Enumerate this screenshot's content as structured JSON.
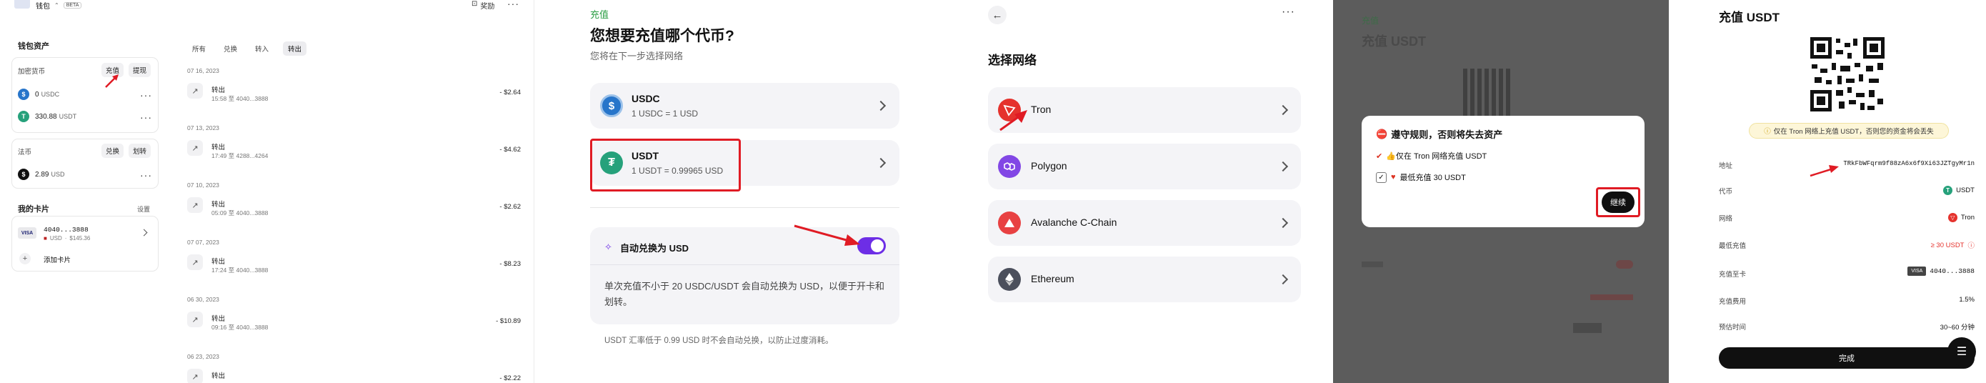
{
  "panel1": {
    "wallet_title": "钱包",
    "beta_badge": "BETA",
    "rewards_label": "奖励",
    "assets_title": "钱包资产",
    "crypto_title": "加密货币",
    "deposit_label": "充值",
    "withdraw_label": "提现",
    "crypto_rows": [
      {
        "amount": "0",
        "symbol": "USDC"
      },
      {
        "amount": "330.88",
        "symbol": "USDT"
      }
    ],
    "fiat_title": "法币",
    "exchange_label": "兑换",
    "transfer_label": "划转",
    "fiat_rows": [
      {
        "amount": "2.89",
        "symbol": "USD"
      }
    ],
    "cards_title": "我的卡片",
    "settings_label": "设置",
    "card": {
      "brand": "VISA",
      "number": "4040...3888",
      "currency": "USD",
      "balance": "$145.36"
    },
    "add_card_label": "添加卡片",
    "tabs": [
      "所有",
      "兑换",
      "转入",
      "转出"
    ],
    "transactions": [
      {
        "date": "07 16, 2023",
        "title": "转出",
        "detail": "15:58 至 4040...3888",
        "amount": "- $2.64"
      },
      {
        "date": "07 13, 2023",
        "title": "转出",
        "detail": "17:49 至 4288...4264",
        "amount": "- $4.62"
      },
      {
        "date": "07 10, 2023",
        "title": "转出",
        "detail": "05:09 至 4040...3888",
        "amount": "- $2.62"
      },
      {
        "date": "07 07, 2023",
        "title": "转出",
        "detail": "17:24 至 4040...3888",
        "amount": "- $8.23"
      },
      {
        "date": "06 30, 2023",
        "title": "转出",
        "detail": "09:16 至 4040...3888",
        "amount": "- $10.89"
      },
      {
        "date": "06 23, 2023",
        "title": "转出",
        "detail": "",
        "amount": "- $2.22"
      }
    ]
  },
  "panel2": {
    "step_label": "充值",
    "heading": "您想要充值哪个代币?",
    "subheading": "您将在下一步选择网络",
    "options": [
      {
        "name": "USDC",
        "rate": "1 USDC = 1 USD"
      },
      {
        "name": "USDT",
        "rate": "1 USDT = 0.99965 USD"
      }
    ],
    "auto_convert_label": "自动兑换为 USD",
    "auto_convert_on": true,
    "auto_convert_desc": "单次充值不小于 20 USDC/USDT 会自动兑换为 USD，以便于开卡和划转。",
    "footnote": "USDT 汇率低于 0.99 USD 时不会自动兑换，以防止过度消耗。"
  },
  "panel3": {
    "heading": "选择网络",
    "networks": [
      "Tron",
      "Polygon",
      "Avalanche C-Chain",
      "Ethereum"
    ]
  },
  "panel4": {
    "bg_step": "充值",
    "bg_title": "充值 USDT",
    "modal_title": "遵守规则，否则将失去资产",
    "rule1": "👍仅在 Tron 网络充值 USDT",
    "rule2": "最低充值 30 USDT",
    "continue_label": "继续"
  },
  "panel5": {
    "title": "充值 USDT",
    "warning": "仅在 Tron 网络上充值 USDT，否则您的资金将会丢失",
    "rows": [
      {
        "label": "地址",
        "value": "TRkFbWFqrm9f88zA6x6f9Xi63JZTgyMr1n"
      },
      {
        "label": "代币",
        "value": "USDT"
      },
      {
        "label": "网络",
        "value": "Tron"
      },
      {
        "label": "最低充值",
        "value": "≥ 30 USDT"
      },
      {
        "label": "充值至卡",
        "value": "4040...3888",
        "badge": "VISA"
      },
      {
        "label": "充值费用",
        "value": "1.5%"
      },
      {
        "label": "预估时间",
        "value": "30~60 分钟"
      }
    ],
    "done_label": "完成"
  },
  "colors": {
    "accent_purple": "#6d2ee6",
    "tether_green": "#26a17b",
    "usdc_blue": "#2775ca",
    "tron_red": "#e5322d",
    "polygon_purple": "#8247e5",
    "annotation_red": "#e01b24"
  }
}
